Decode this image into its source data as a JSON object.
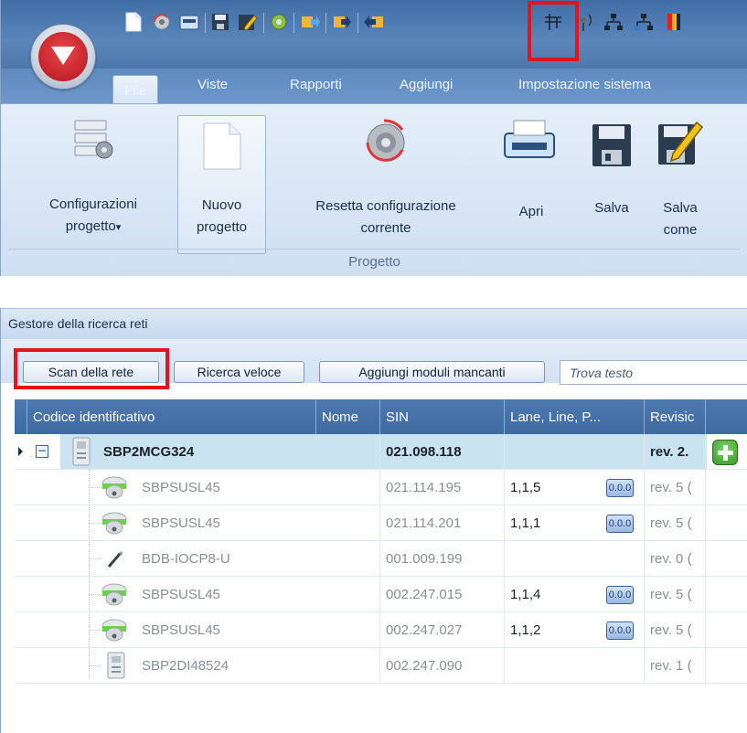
{
  "ribbon": {
    "tabs": [
      "File",
      "Viste",
      "Rapporti",
      "Aggiungi",
      "Impostazione sistema"
    ],
    "buttons": {
      "config_line1": "Configurazioni",
      "config_line2": "progetto",
      "config_arrow": "▾",
      "new_line1": "Nuovo",
      "new_line2": "progetto",
      "reset_line1": "Resetta configurazione",
      "reset_line2": "corrente",
      "open": "Apri",
      "save": "Salva",
      "saveas_line1": "Salva",
      "saveas_line2": "come"
    },
    "group_label": "Progetto",
    "quick_access_icons": [
      "new-document-icon",
      "reset-config-icon",
      "open-icon",
      "save-icon",
      "save-as-icon",
      "settings-icon",
      "import-icon",
      "export-icon",
      "import-export-icon",
      "network-scan-icon",
      "antenna-icon",
      "topology-icon",
      "topology-alt-icon",
      "color-icon"
    ]
  },
  "network": {
    "title": "Gestore della ricerca reti",
    "toolbar": {
      "scan": "Scan della rete",
      "quick_search": "Ricerca veloce",
      "add_missing": "Aggiungi moduli mancanti",
      "search_placeholder": "Trova testo"
    },
    "columns": [
      "Codice identificativo",
      "Nome",
      "SIN",
      "Lane, Line, P...",
      "Revisic"
    ],
    "rows": [
      {
        "code": "SBP2MCG324",
        "name": "",
        "sin": "021.098.118",
        "lane": "",
        "rev": "rev. 2.",
        "badge": "",
        "level": 0
      },
      {
        "code": "SBPSUSL45",
        "name": "",
        "sin": "021.114.195",
        "lane": "1,1,5",
        "rev": "rev. 5 (",
        "badge": "0.0.0",
        "level": 1
      },
      {
        "code": "SBPSUSL45",
        "name": "",
        "sin": "021.114.201",
        "lane": "1,1,1",
        "rev": "rev. 5 (",
        "badge": "0.0.0",
        "level": 1
      },
      {
        "code": "BDB-IOCP8-U",
        "name": "",
        "sin": "001.009.199",
        "lane": "",
        "rev": "rev. 0 (",
        "badge": "",
        "level": 1
      },
      {
        "code": "SBPSUSL45",
        "name": "",
        "sin": "002.247.015",
        "lane": "1,1,4",
        "rev": "rev. 5 (",
        "badge": "0.0.0",
        "level": 1
      },
      {
        "code": "SBPSUSL45",
        "name": "",
        "sin": "002.247.027",
        "lane": "1,1,2",
        "rev": "rev. 5 (",
        "badge": "0.0.0",
        "level": 1
      },
      {
        "code": "SBP2DI48524",
        "name": "",
        "sin": "002.247.090",
        "lane": "",
        "rev": "rev. 1 (",
        "badge": "",
        "level": 1
      }
    ]
  },
  "colors": {
    "highlight": "#e3141b",
    "header_blue": "#4470a8",
    "selected_row": "#c9e3f0",
    "add_green": "#49b43a"
  }
}
